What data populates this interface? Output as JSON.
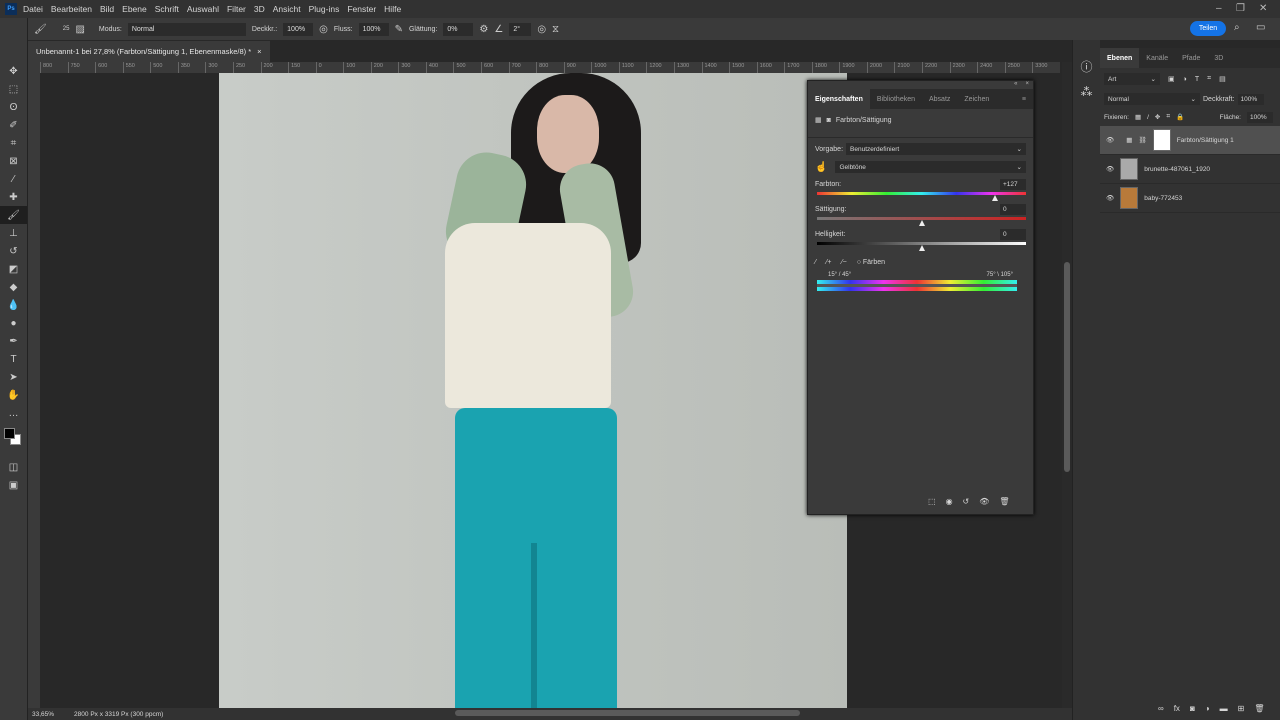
{
  "menu": [
    "Datei",
    "Bearbeiten",
    "Bild",
    "Ebene",
    "Schrift",
    "Auswahl",
    "Filter",
    "3D",
    "Ansicht",
    "Plug-ins",
    "Fenster",
    "Hilfe"
  ],
  "app_logo": "Ps",
  "options": {
    "brush_size": "25",
    "modus_label": "Modus:",
    "modus": "Normal",
    "deckkr_label": "Deckkr.:",
    "deckkr": "100%",
    "fluss_label": "Fluss:",
    "fluss": "100%",
    "glaettung_label": "Glättung:",
    "glaettung": "0%",
    "angle": "2°",
    "share": "Teilen"
  },
  "document_tab": "Unbenannt-1 bei 27,8% (Farbton/Sättigung 1, Ebenenmaske/8) *",
  "ruler_ticks": [
    "800",
    "750",
    "600",
    "550",
    "500",
    "350",
    "300",
    "250",
    "200",
    "150",
    "0",
    "100",
    "200",
    "300",
    "400",
    "500",
    "600",
    "700",
    "800",
    "900",
    "1000",
    "1100",
    "1200",
    "1300",
    "1400",
    "1500",
    "1600",
    "1700",
    "1800",
    "1900",
    "2000",
    "2100",
    "2200",
    "2300",
    "2400",
    "2500",
    "3300"
  ],
  "status": {
    "zoom": "33,65%",
    "size": "2800 Px x 3319 Px (300 ppcm)"
  },
  "properties": {
    "tabs": [
      "Eigenschaften",
      "Bibliotheken",
      "Absatz",
      "Zeichen"
    ],
    "title": "Farbton/Sättigung",
    "vorgabe_label": "Vorgabe:",
    "vorgabe": "Benutzerdefiniert",
    "range": "Gelbtöne",
    "farbton_label": "Farbton:",
    "farbton": "+127",
    "farbton_pos": 0.85,
    "saettigung_label": "Sättigung:",
    "saettigung": "0",
    "saettigung_pos": 0.5,
    "helligkeit_label": "Helligkeit:",
    "helligkeit": "0",
    "helligkeit_pos": 0.5,
    "faerben": "Färben",
    "range_left": "15° / 45°",
    "range_right": "75° \\ 105°"
  },
  "layers": {
    "tabs": [
      "Ebenen",
      "Kanäle",
      "Pfade",
      "3D"
    ],
    "filter": "Art",
    "blend": "Normal",
    "deckkraft_label": "Deckkraft:",
    "deckkraft": "100%",
    "fixieren_label": "Fixieren:",
    "flaeche_label": "Fläche:",
    "flaeche": "100%",
    "items": [
      {
        "name": "Farbton/Sättigung 1",
        "selected": true
      },
      {
        "name": "brunette-487061_1920"
      },
      {
        "name": "baby-772453"
      }
    ]
  },
  "colors": {
    "accent": "#1473e6",
    "canvas_bg": "#c3c7c2",
    "jeans": "#1aa3b0"
  }
}
